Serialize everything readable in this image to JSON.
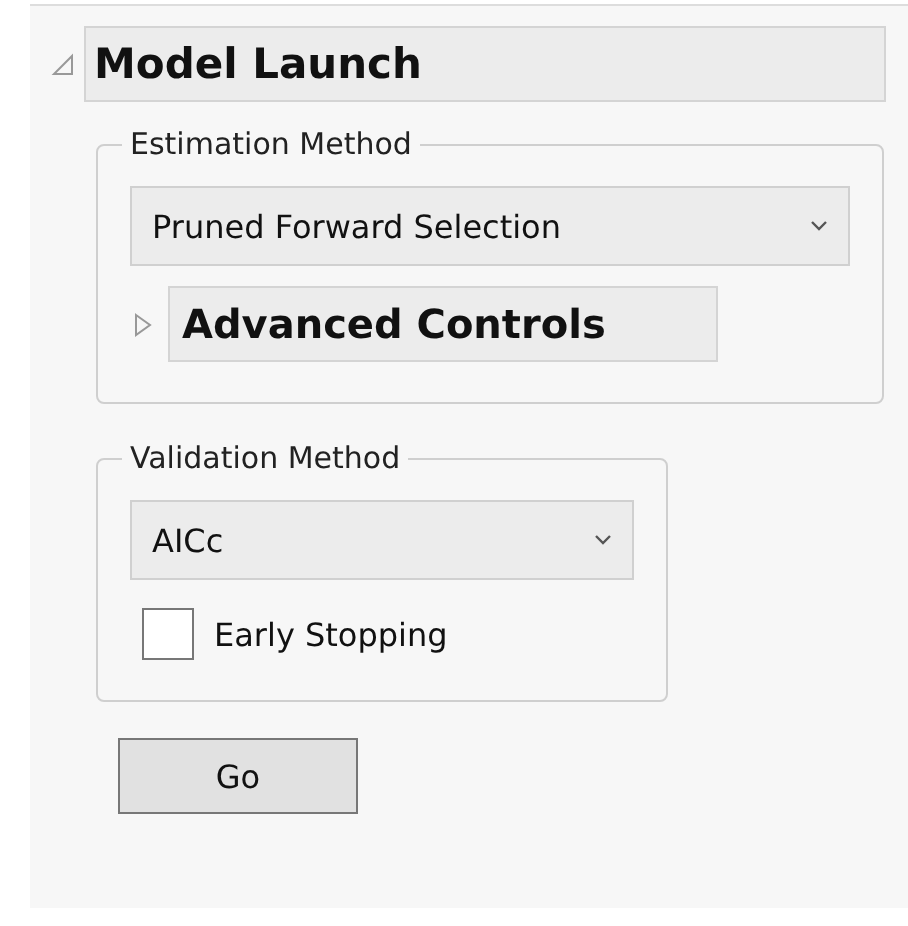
{
  "outline": {
    "title": "Model Launch",
    "expanded": true
  },
  "estimation": {
    "legend": "Estimation Method",
    "dropdown": {
      "value": "Pruned Forward Selection"
    },
    "advanced": {
      "title": "Advanced Controls",
      "expanded": false
    }
  },
  "validation": {
    "legend": "Validation Method",
    "dropdown": {
      "value": "AICc"
    },
    "early_stopping": {
      "label": "Early Stopping",
      "checked": false
    }
  },
  "buttons": [
    "Go"
  ]
}
